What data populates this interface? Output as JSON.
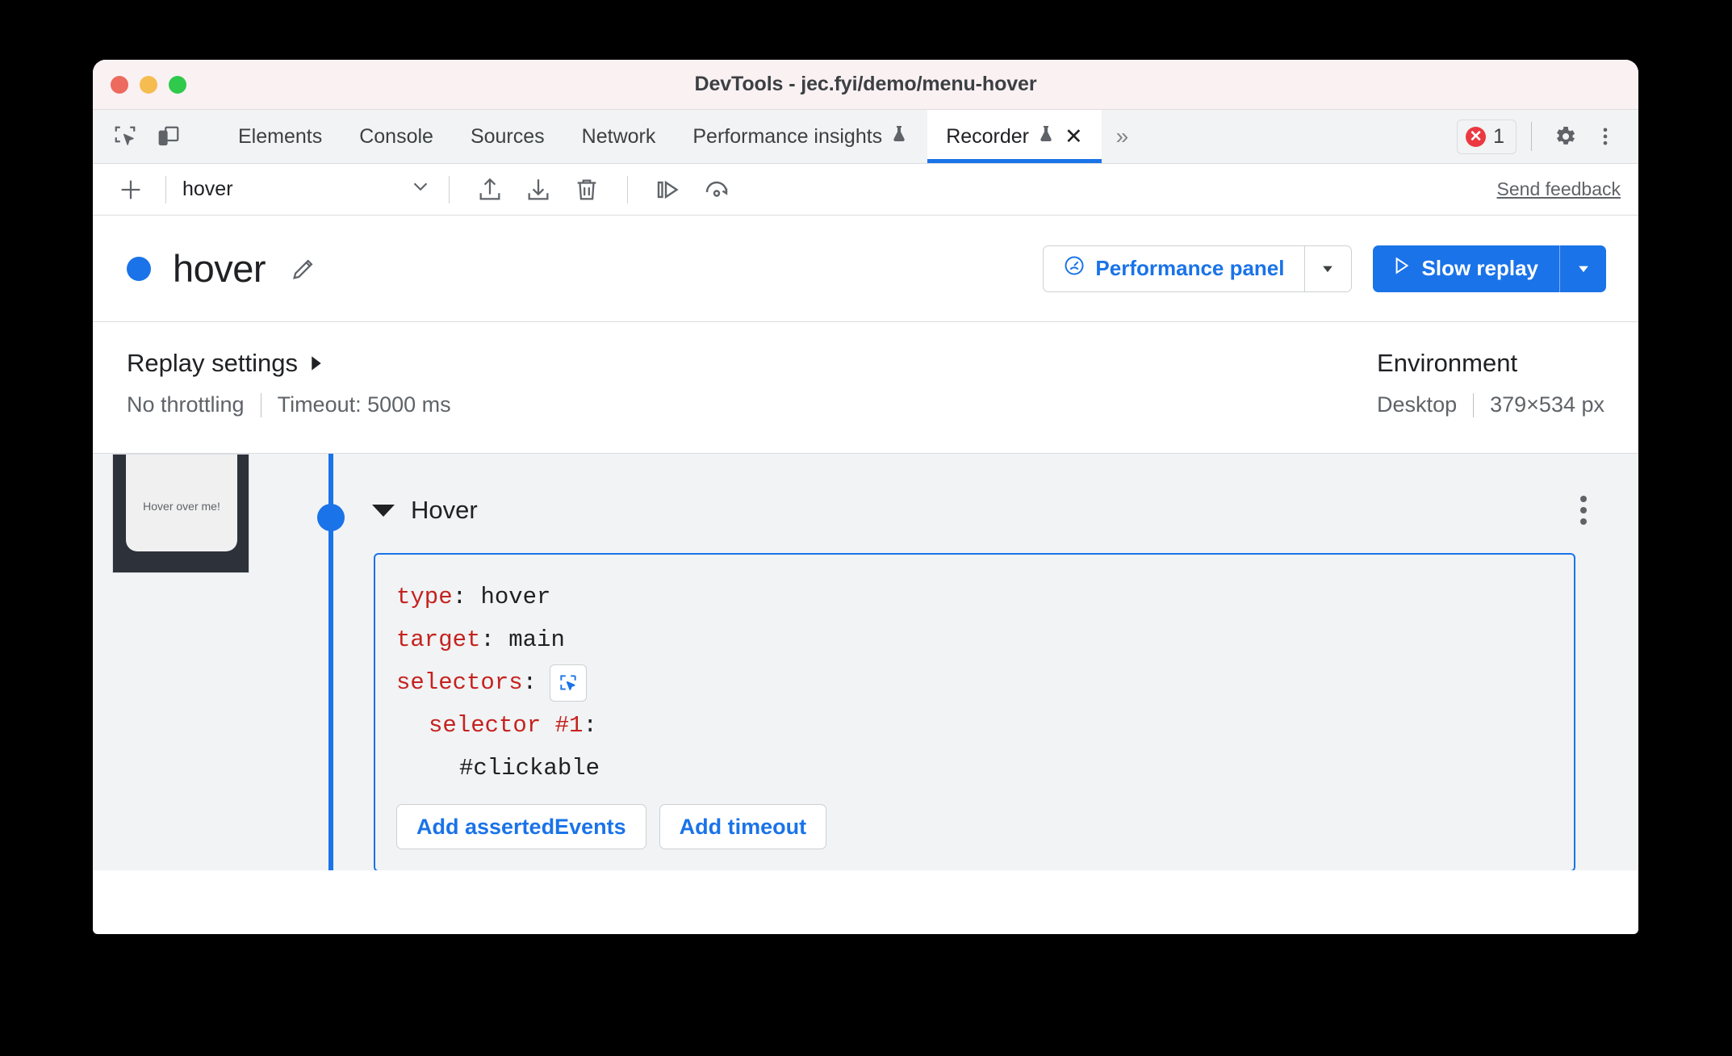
{
  "window": {
    "title": "DevTools - jec.fyi/demo/menu-hover",
    "traffic_lights": [
      "close-red",
      "minimize-yellow",
      "maximize-green"
    ]
  },
  "tabbar": {
    "left_icons": [
      "inspect-element-icon",
      "device-toolbar-icon"
    ],
    "tabs": [
      {
        "label": "Elements",
        "active": false,
        "experimental": false,
        "closable": false
      },
      {
        "label": "Console",
        "active": false,
        "experimental": false,
        "closable": false
      },
      {
        "label": "Sources",
        "active": false,
        "experimental": false,
        "closable": false
      },
      {
        "label": "Network",
        "active": false,
        "experimental": false,
        "closable": false
      },
      {
        "label": "Performance insights",
        "active": false,
        "experimental": true,
        "closable": false
      },
      {
        "label": "Recorder",
        "active": true,
        "experimental": true,
        "closable": true
      }
    ],
    "overflow_label": "»",
    "error_count": "1",
    "right_icons": [
      "gear-icon",
      "kebab-menu-icon"
    ]
  },
  "recorder_toolbar": {
    "add_label": "+",
    "recording_name": "hover",
    "icons": [
      "export-icon",
      "import-icon",
      "delete-icon",
      "step-over-icon",
      "replay-icon"
    ],
    "feedback_label": "Send feedback"
  },
  "recording_header": {
    "title": "hover",
    "edit_icon": "pencil-icon",
    "performance_button": {
      "label": "Performance panel",
      "icon": "performance-gauge-icon"
    },
    "replay_button": {
      "label": "Slow replay",
      "icon": "play-icon"
    }
  },
  "settings": {
    "replay": {
      "heading": "Replay settings",
      "throttling": "No throttling",
      "timeout": "Timeout: 5000 ms"
    },
    "environment": {
      "heading": "Environment",
      "device": "Desktop",
      "viewport": "379×534 px"
    }
  },
  "steps": {
    "thumbnail_text": "Hover over me!",
    "step": {
      "name": "Hover",
      "code": {
        "type_key": "type",
        "type_value": "hover",
        "target_key": "target",
        "target_value": "main",
        "selectors_key": "selectors",
        "selector_1_key": "selector #1",
        "selector_1_value": "#clickable",
        "picker_icon": "select-element-icon"
      },
      "actions": {
        "add_asserted_events": "Add assertedEvents",
        "add_timeout": "Add timeout"
      }
    }
  },
  "colors": {
    "accent": "#1a73e8",
    "error": "#eb3941",
    "code_key": "#c5221f",
    "panel_bg": "#f1f3f4",
    "titlebar_bg": "#faf1f3"
  }
}
